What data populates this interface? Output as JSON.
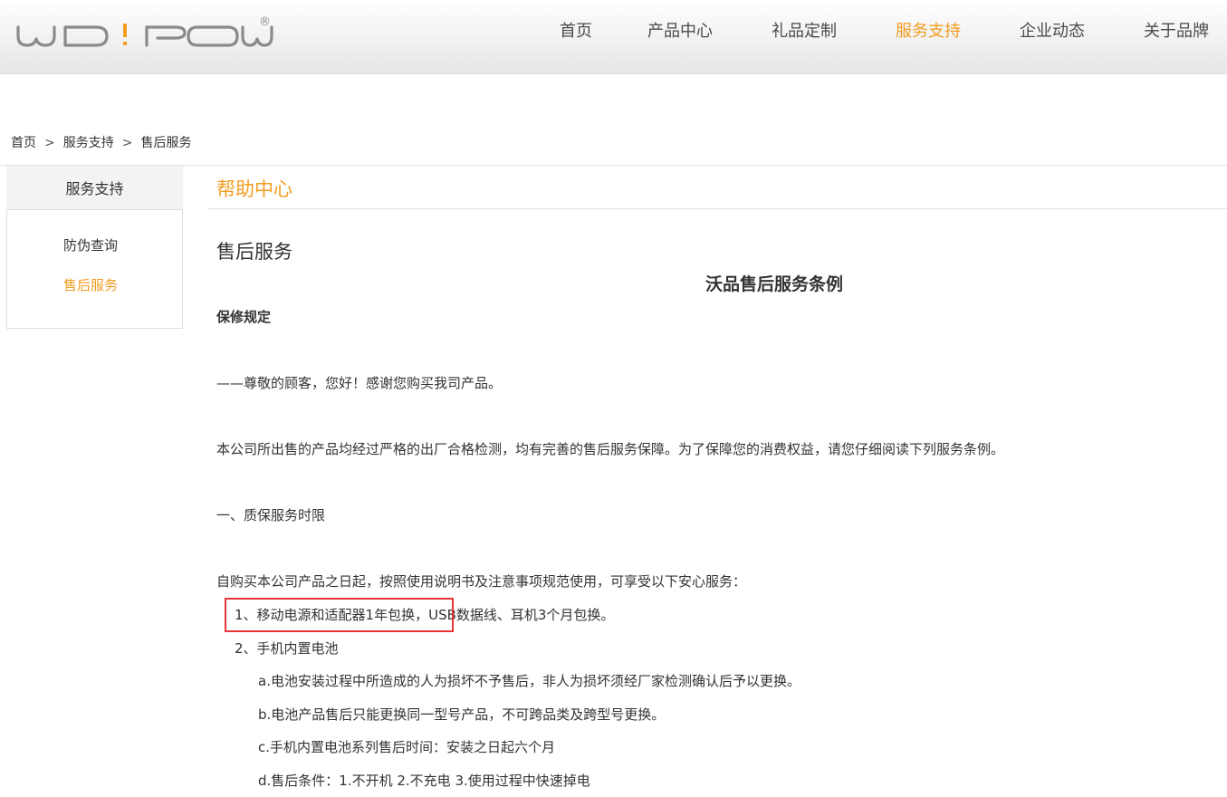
{
  "header": {
    "logo_text": "WO!POW®",
    "nav": [
      {
        "label": "首页"
      },
      {
        "label": "产品中心"
      },
      {
        "label": "礼品定制"
      },
      {
        "label": "服务支持"
      },
      {
        "label": "企业动态"
      },
      {
        "label": "关于品牌"
      }
    ],
    "active_nav": "服务支持"
  },
  "breadcrumb": [
    "首页",
    "服务支持",
    "售后服务"
  ],
  "breadcrumb_sep": ">",
  "sidebar": {
    "title": "服务支持",
    "items": [
      {
        "label": "防伪查询"
      },
      {
        "label": "售后服务"
      }
    ],
    "active_item": "售后服务"
  },
  "main": {
    "help_title": "帮助中心",
    "page_title": "售后服务",
    "doc_title": "沃品售后服务条例",
    "section_heading": "保修规定",
    "greeting": "——尊敬的顾客，您好！感谢您购买我司产品。",
    "intro": "本公司所出售的产品均经过严格的出厂合格检测，均有完善的售后服务保障。为了保障您的消费权益，请您仔细阅读下列服务条例。",
    "warranty_heading": "一、质保服务时限",
    "warranty_intro": "自购买本公司产品之日起，按照使用说明书及注意事项规范使用，可享受以下安心服务：",
    "item1": "1、移动电源和适配器1年包换，USB数据线、耳机3个月包换。",
    "item2": "2、手机内置电池",
    "sub_a": "a.电池安装过程中所造成的人为损坏不予售后，非人为损坏须经厂家检测确认后予以更换。",
    "sub_b": "b.电池产品售后只能更换同一型号产品，不可跨品类及跨型号更换。",
    "sub_c": "c.手机内置电池系列售后时间：安装之日起六个月",
    "sub_d": "d.售后条件：1.不开机  2.不充电  3.使用过程中快速掉电"
  },
  "colors": {
    "accent": "#f29d20",
    "highlight_border": "#e53535"
  }
}
